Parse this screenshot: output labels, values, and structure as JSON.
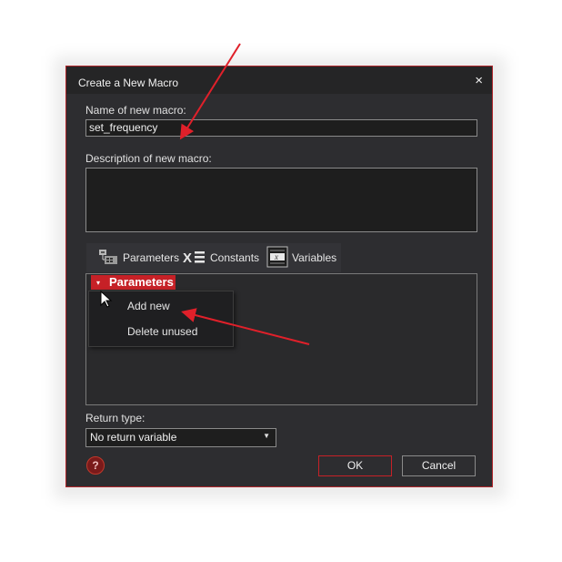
{
  "dialog": {
    "title": "Create a New Macro",
    "close_glyph": "×",
    "name_label": "Name of new macro:",
    "name_value": "set_frequency",
    "description_label": "Description of new macro:",
    "description_value": "",
    "tabs": [
      {
        "label": "Parameters",
        "icon": "parameters-icon"
      },
      {
        "label": "Constants",
        "icon": "constants-icon"
      },
      {
        "label": "Variables",
        "icon": "variables-icon"
      }
    ],
    "tree": {
      "root_label": "Parameters",
      "toggle_glyph": "▾"
    },
    "context_menu": {
      "items": [
        "Add new",
        "Delete unused"
      ]
    },
    "return_type_label": "Return type:",
    "return_type_value": "No return variable",
    "help_glyph": "?",
    "ok_label": "OK",
    "cancel_label": "Cancel"
  },
  "colors": {
    "accent": "#c62127",
    "annotation_arrow": "#e0202a",
    "dialog_bg": "#2d2d30"
  }
}
